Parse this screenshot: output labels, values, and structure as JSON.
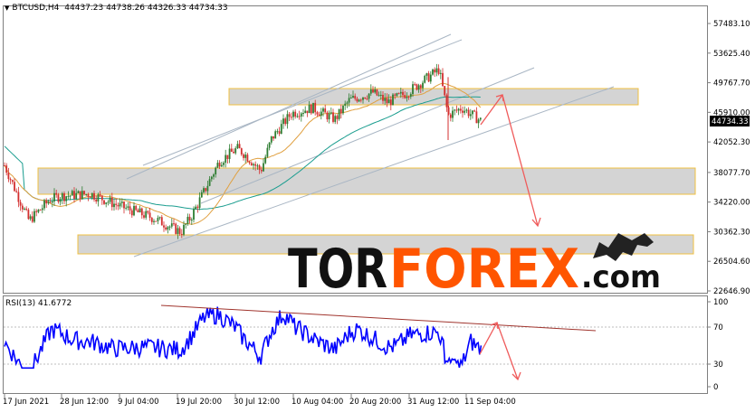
{
  "header": {
    "symbol": "BTCUSD,H4",
    "ohlc": "44437.23 44738.26 44326.33 44734.33"
  },
  "rsi": {
    "label": "RSI(13) 41.6772",
    "levels": [
      "100",
      "70",
      "30",
      "0"
    ]
  },
  "current_price": "44734.33",
  "price_axis": [
    "57483.10",
    "53625.40",
    "49767.70",
    "45910.00",
    "42052.30",
    "38077.70",
    "34220.00",
    "30362.30",
    "26504.60",
    "22646.90"
  ],
  "time_axis": [
    "17 Jun 2021",
    "28 Jun 12:00",
    "9 Jul 04:00",
    "19 Jul 20:00",
    "30 Jul 12:00",
    "10 Aug 04:00",
    "20 Aug 20:00",
    "31 Aug 12:00",
    "11 Sep 04:00"
  ],
  "watermark": {
    "part1": "TOR",
    "part2": "FOREX",
    "part3": ".com"
  },
  "colors": {
    "bull": "#2e7d32",
    "bear": "#d32f2f",
    "ma_slow": "#1a9d8f",
    "ma_fast": "#e0a040",
    "channel": "#a9b6c4",
    "zone_fill": "#d4d4d4",
    "zone_border": "#f0c040",
    "rsi_line": "#0000ff",
    "arrow": "#ef5b5b",
    "trend_line": "#a0342d",
    "accent": "#ff5500"
  },
  "chart_data": {
    "type": "candlestick",
    "symbol": "BTCUSD",
    "timeframe": "H4",
    "last": {
      "open": 44437.23,
      "high": 44738.26,
      "low": 44326.33,
      "close": 44734.33
    },
    "y_axis_ticks": [
      57483.1,
      53625.4,
      49767.7,
      45910.0,
      42052.3,
      38077.7,
      34220.0,
      30362.3,
      26504.6,
      22646.9
    ],
    "x_axis_ticks": [
      "17 Jun 2021",
      "28 Jun 12:00",
      "9 Jul 04:00",
      "19 Jul 20:00",
      "30 Jul 12:00",
      "10 Aug 04:00",
      "20 Aug 20:00",
      "31 Aug 12:00",
      "11 Sep 04:00"
    ],
    "path": [
      {
        "t": "17 Jun 2021",
        "price": 39000
      },
      {
        "t": "19 Jun",
        "price": 35500
      },
      {
        "t": "22 Jun",
        "price": 31800
      },
      {
        "t": "25 Jun",
        "price": 34500
      },
      {
        "t": "28 Jun 12:00",
        "price": 35000
      },
      {
        "t": "4 Jul",
        "price": 35300
      },
      {
        "t": "9 Jul 04:00",
        "price": 33800
      },
      {
        "t": "15 Jul",
        "price": 32100
      },
      {
        "t": "19 Jul 20:00",
        "price": 30300
      },
      {
        "t": "22 Jul",
        "price": 32500
      },
      {
        "t": "25 Jul",
        "price": 35500
      },
      {
        "t": "27 Jul",
        "price": 39500
      },
      {
        "t": "29 Jul",
        "price": 41200
      },
      {
        "t": "30 Jul 12:00",
        "price": 40500
      },
      {
        "t": "3 Aug",
        "price": 38300
      },
      {
        "t": "6 Aug",
        "price": 42500
      },
      {
        "t": "10 Aug 04:00",
        "price": 45800
      },
      {
        "t": "13 Aug",
        "price": 46500
      },
      {
        "t": "17 Aug",
        "price": 45000
      },
      {
        "t": "20 Aug 20:00",
        "price": 47500
      },
      {
        "t": "25 Aug",
        "price": 48500
      },
      {
        "t": "29 Aug",
        "price": 47200
      },
      {
        "t": "31 Aug 12:00",
        "price": 48500
      },
      {
        "t": "5 Sep",
        "price": 51500
      },
      {
        "t": "7 Sep",
        "price": 45500
      },
      {
        "t": "9 Sep",
        "price": 46500
      },
      {
        "t": "11 Sep 04:00",
        "price": 44734.33
      }
    ],
    "zones": [
      {
        "from": 45910,
        "to": 48900
      },
      {
        "from": 34700,
        "to": 38900
      },
      {
        "from": 28500,
        "to": 30800
      }
    ],
    "rsi_period": 13,
    "rsi_value": 41.6772,
    "rsi_levels": [
      100,
      70,
      30,
      0
    ]
  }
}
